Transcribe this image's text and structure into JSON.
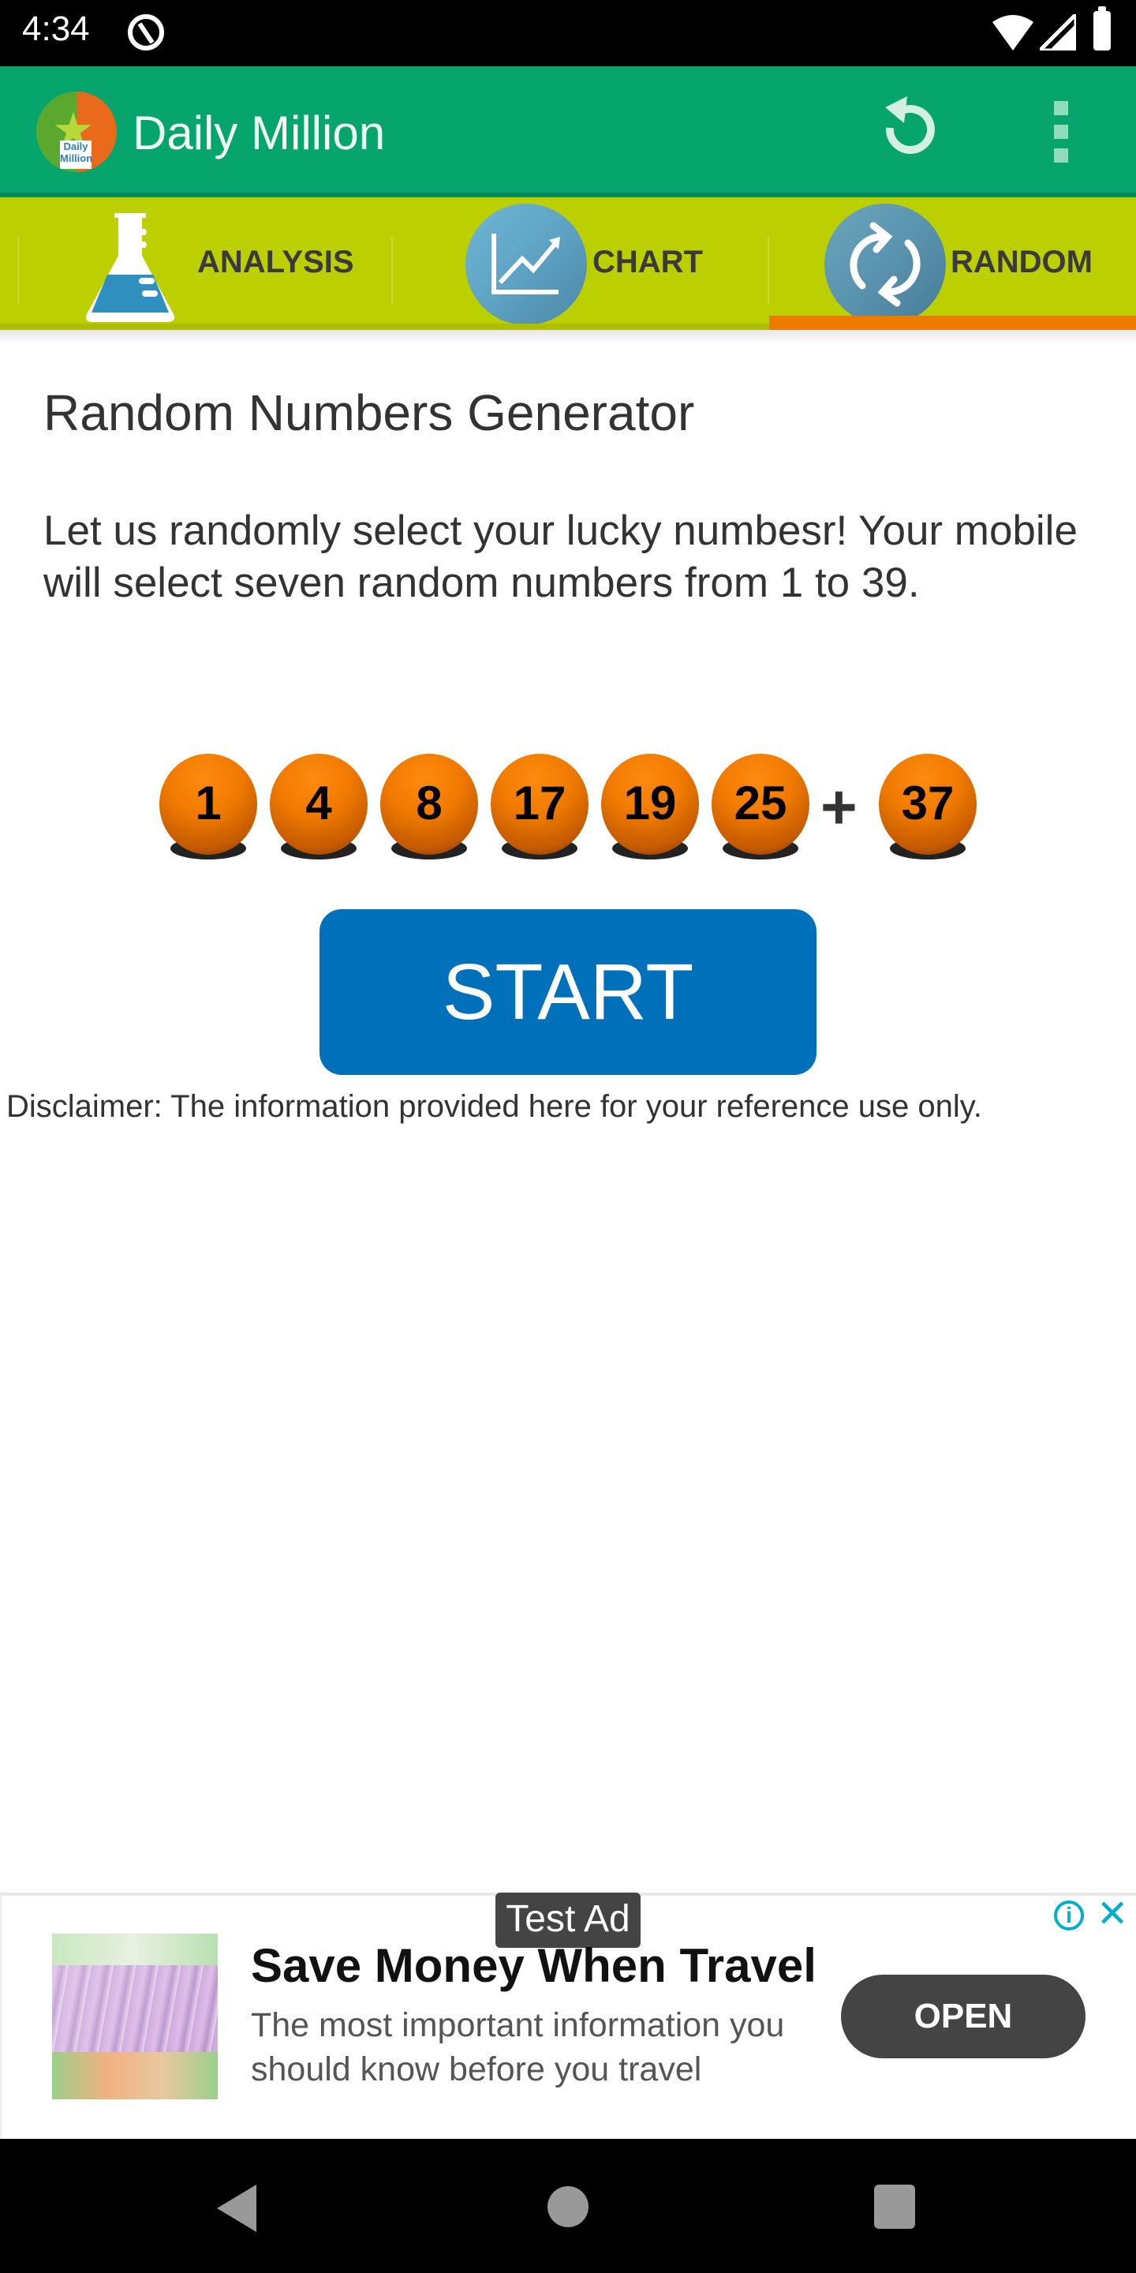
{
  "status_bar": {
    "time": "4:34",
    "icons": [
      "at-sign-icon",
      "wifi-icon",
      "signal-icon",
      "battery-icon"
    ]
  },
  "app_bar": {
    "title": "Daily Million",
    "logo_label": "Daily Million",
    "actions": [
      "refresh-icon",
      "overflow-menu-icon"
    ],
    "color": "#06A56D"
  },
  "tabs": {
    "items": [
      {
        "label": "ANALYSIS",
        "icon": "flask-icon"
      },
      {
        "label": "CHART",
        "icon": "line-chart-icon"
      },
      {
        "label": "RANDOM",
        "icon": "sync-icon"
      }
    ],
    "selected": "RANDOM",
    "bar_color": "#BCCF00",
    "indicator_color": "#EF7A00"
  },
  "main": {
    "title": "Random Numbers Generator",
    "description": "Let us randomly select your lucky numbesr! Your mobile will select seven random numbers from 1 to 39.",
    "numbers": [
      "1",
      "4",
      "8",
      "17",
      "19",
      "25"
    ],
    "plus": "+",
    "bonus_number": "37",
    "start_label": "START",
    "start_color": "#0070BB",
    "disclaimer": "Disclaimer: The information provided here for your reference use only."
  },
  "ad": {
    "badge": "Test Ad",
    "headline": "Save Money When Travel",
    "body": "The most important information you should know before you travel",
    "cta": "OPEN",
    "info_glyph": "i",
    "close_glyph": "✕"
  },
  "nav_bar": {
    "buttons": [
      "back",
      "home",
      "recents"
    ]
  }
}
